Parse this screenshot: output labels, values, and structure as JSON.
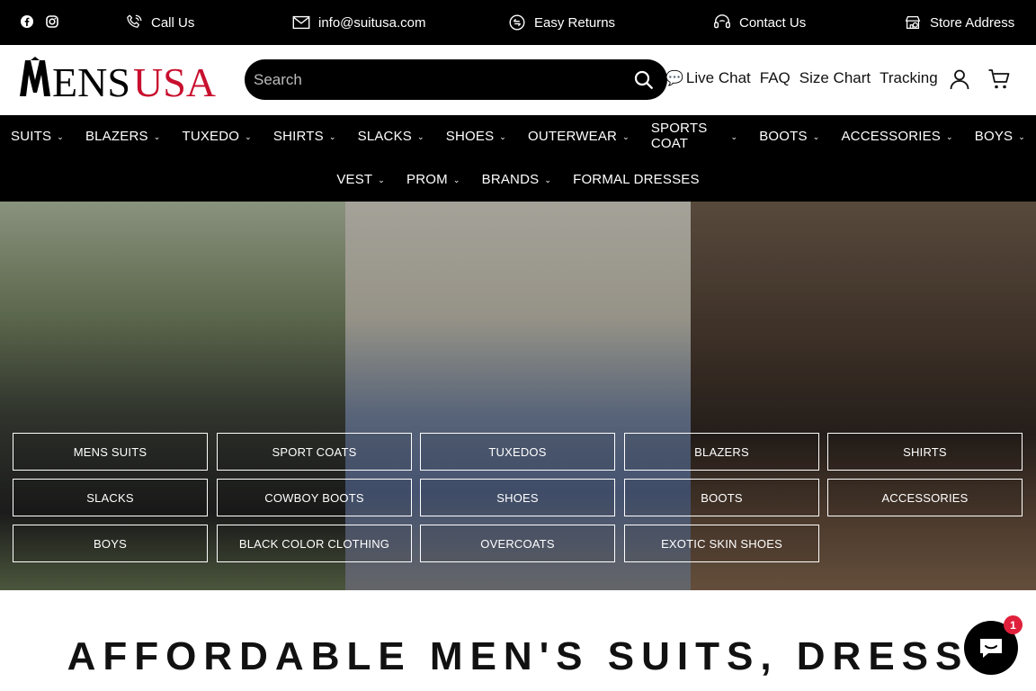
{
  "topbar": {
    "call": "Call Us",
    "email": "info@suitusa.com",
    "returns": "Easy Returns",
    "contact": "Contact Us",
    "store": "Store Address"
  },
  "header": {
    "logo_text": "MENSUSA",
    "search_placeholder": "Search",
    "links": [
      "Live Chat",
      "FAQ",
      "Size Chart",
      "Tracking"
    ]
  },
  "nav": {
    "row1": [
      "SUITS",
      "BLAZERS",
      "TUXEDO",
      "SHIRTS",
      "SLACKS",
      "SHOES",
      "OUTERWEAR",
      "SPORTS COAT",
      "BOOTS",
      "ACCESSORIES",
      "BOYS"
    ],
    "row2": [
      "VEST",
      "PROM",
      "BRANDS",
      "FORMAL DRESSES"
    ],
    "row2_no_chevron": "FORMAL DRESSES"
  },
  "hero": {
    "categories": [
      "MENS SUITS",
      "SPORT COATS",
      "TUXEDOS",
      "BLAZERS",
      "SHIRTS",
      "SLACKS",
      "COWBOY BOOTS",
      "SHOES",
      "BOOTS",
      "ACCESSORIES",
      "BOYS",
      "BLACK COLOR CLOTHING",
      "OVERCOATS",
      "EXOTIC SKIN SHOES"
    ]
  },
  "heading": "AFFORDABLE MEN'S SUITS, DRESS",
  "chat": {
    "badge": "1"
  },
  "colors": {
    "brand_red": "#c8102e",
    "bar": "#000000"
  }
}
